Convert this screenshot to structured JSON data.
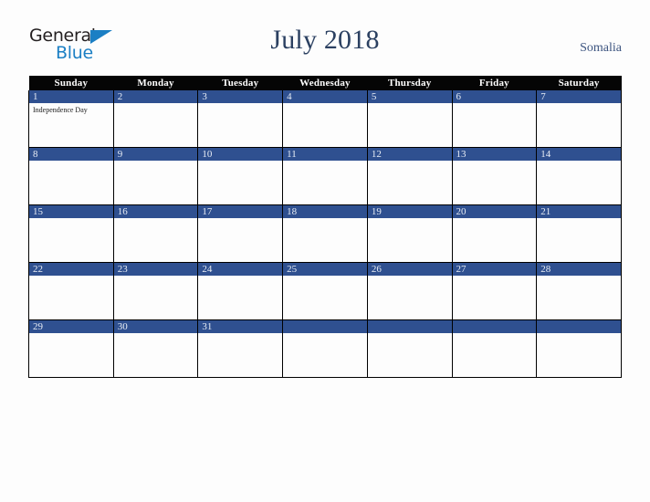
{
  "logo": {
    "name": "general-blue-logo",
    "line1": "General",
    "line2": "Blue",
    "triangle_color": "#1b7fc4",
    "text_color": "#231f20"
  },
  "header": {
    "title": "July 2018",
    "country": "Somalia",
    "title_color": "#2b4061",
    "country_color": "#3d5580"
  },
  "calendar": {
    "weekday_headers": [
      "Sunday",
      "Monday",
      "Tuesday",
      "Wednesday",
      "Thursday",
      "Friday",
      "Saturday"
    ],
    "header_bg": "#050505",
    "header_text_color": "#ffffff",
    "date_band_color": "#2f5090",
    "date_text_color": "#e8edf5",
    "cell_bg": "#fdfdfd",
    "grid_line_color": "#000000",
    "weeks": [
      [
        {
          "date": "1",
          "events": [
            "Independence Day"
          ]
        },
        {
          "date": "2",
          "events": []
        },
        {
          "date": "3",
          "events": []
        },
        {
          "date": "4",
          "events": []
        },
        {
          "date": "5",
          "events": []
        },
        {
          "date": "6",
          "events": []
        },
        {
          "date": "7",
          "events": []
        }
      ],
      [
        {
          "date": "8",
          "events": []
        },
        {
          "date": "9",
          "events": []
        },
        {
          "date": "10",
          "events": []
        },
        {
          "date": "11",
          "events": []
        },
        {
          "date": "12",
          "events": []
        },
        {
          "date": "13",
          "events": []
        },
        {
          "date": "14",
          "events": []
        }
      ],
      [
        {
          "date": "15",
          "events": []
        },
        {
          "date": "16",
          "events": []
        },
        {
          "date": "17",
          "events": []
        },
        {
          "date": "18",
          "events": []
        },
        {
          "date": "19",
          "events": []
        },
        {
          "date": "20",
          "events": []
        },
        {
          "date": "21",
          "events": []
        }
      ],
      [
        {
          "date": "22",
          "events": []
        },
        {
          "date": "23",
          "events": []
        },
        {
          "date": "24",
          "events": []
        },
        {
          "date": "25",
          "events": []
        },
        {
          "date": "26",
          "events": []
        },
        {
          "date": "27",
          "events": []
        },
        {
          "date": "28",
          "events": []
        }
      ],
      [
        {
          "date": "29",
          "events": []
        },
        {
          "date": "30",
          "events": []
        },
        {
          "date": "31",
          "events": []
        },
        {
          "date": "",
          "events": []
        },
        {
          "date": "",
          "events": []
        },
        {
          "date": "",
          "events": []
        },
        {
          "date": "",
          "events": []
        }
      ]
    ]
  }
}
